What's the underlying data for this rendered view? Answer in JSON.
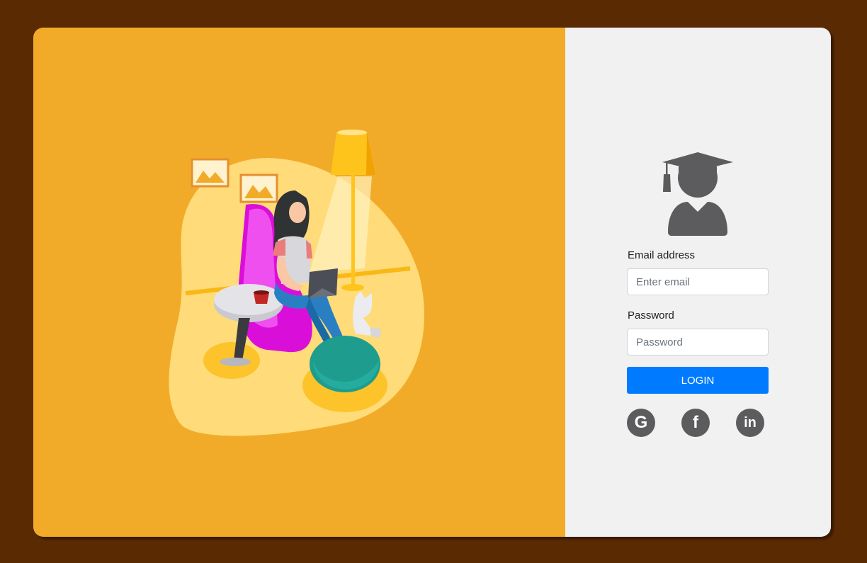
{
  "form": {
    "email_label": "Email address",
    "email_placeholder": "Enter email",
    "email_value": "",
    "password_label": "Password",
    "password_placeholder": "Password",
    "password_value": "",
    "login_label": "LOGIN"
  },
  "social": {
    "google_glyph": "G",
    "facebook_glyph": "f",
    "linkedin_glyph": "in"
  },
  "colors": {
    "page_background": "#5a2a02",
    "illustration_panel": "#f2ab29",
    "form_panel": "#f1f1f1",
    "primary_button": "#007bff",
    "icon_gray": "#5c5b5d"
  },
  "icons": {
    "avatar": "graduate-user-icon",
    "google": "google-icon",
    "facebook": "facebook-icon",
    "linkedin": "linkedin-icon"
  }
}
